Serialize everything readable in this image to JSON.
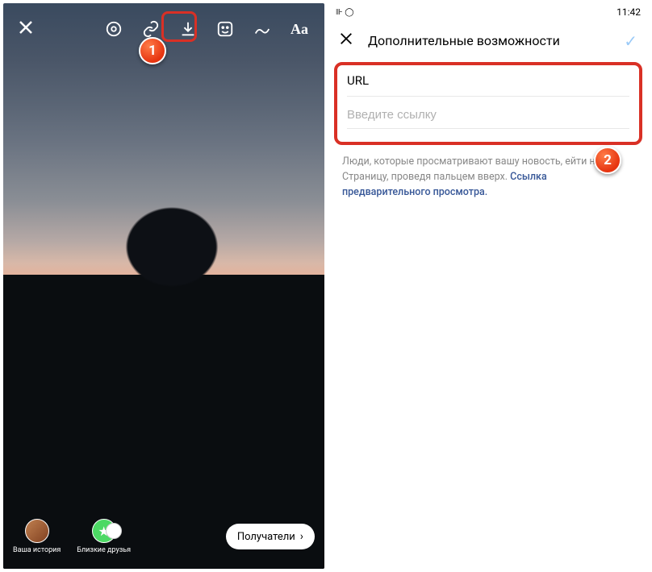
{
  "left": {
    "story_options": {
      "your_story": "Ваша история",
      "close_friends": "Близкие друзья"
    },
    "recipients_button": "Получатели",
    "text_tool": "Aa"
  },
  "right": {
    "status_time": "11:42",
    "header_title": "Дополнительные возможности",
    "url_label": "URL",
    "url_placeholder": "Введите ссылку",
    "helper_text_1": "Люди, которые просматривают вашу новость, ",
    "helper_text_2": "ейти на эту Страницу, проведя пальцем вверх. ",
    "helper_link": "Ссылка предварительного просмотра."
  },
  "callouts": {
    "one": "1",
    "two": "2"
  }
}
